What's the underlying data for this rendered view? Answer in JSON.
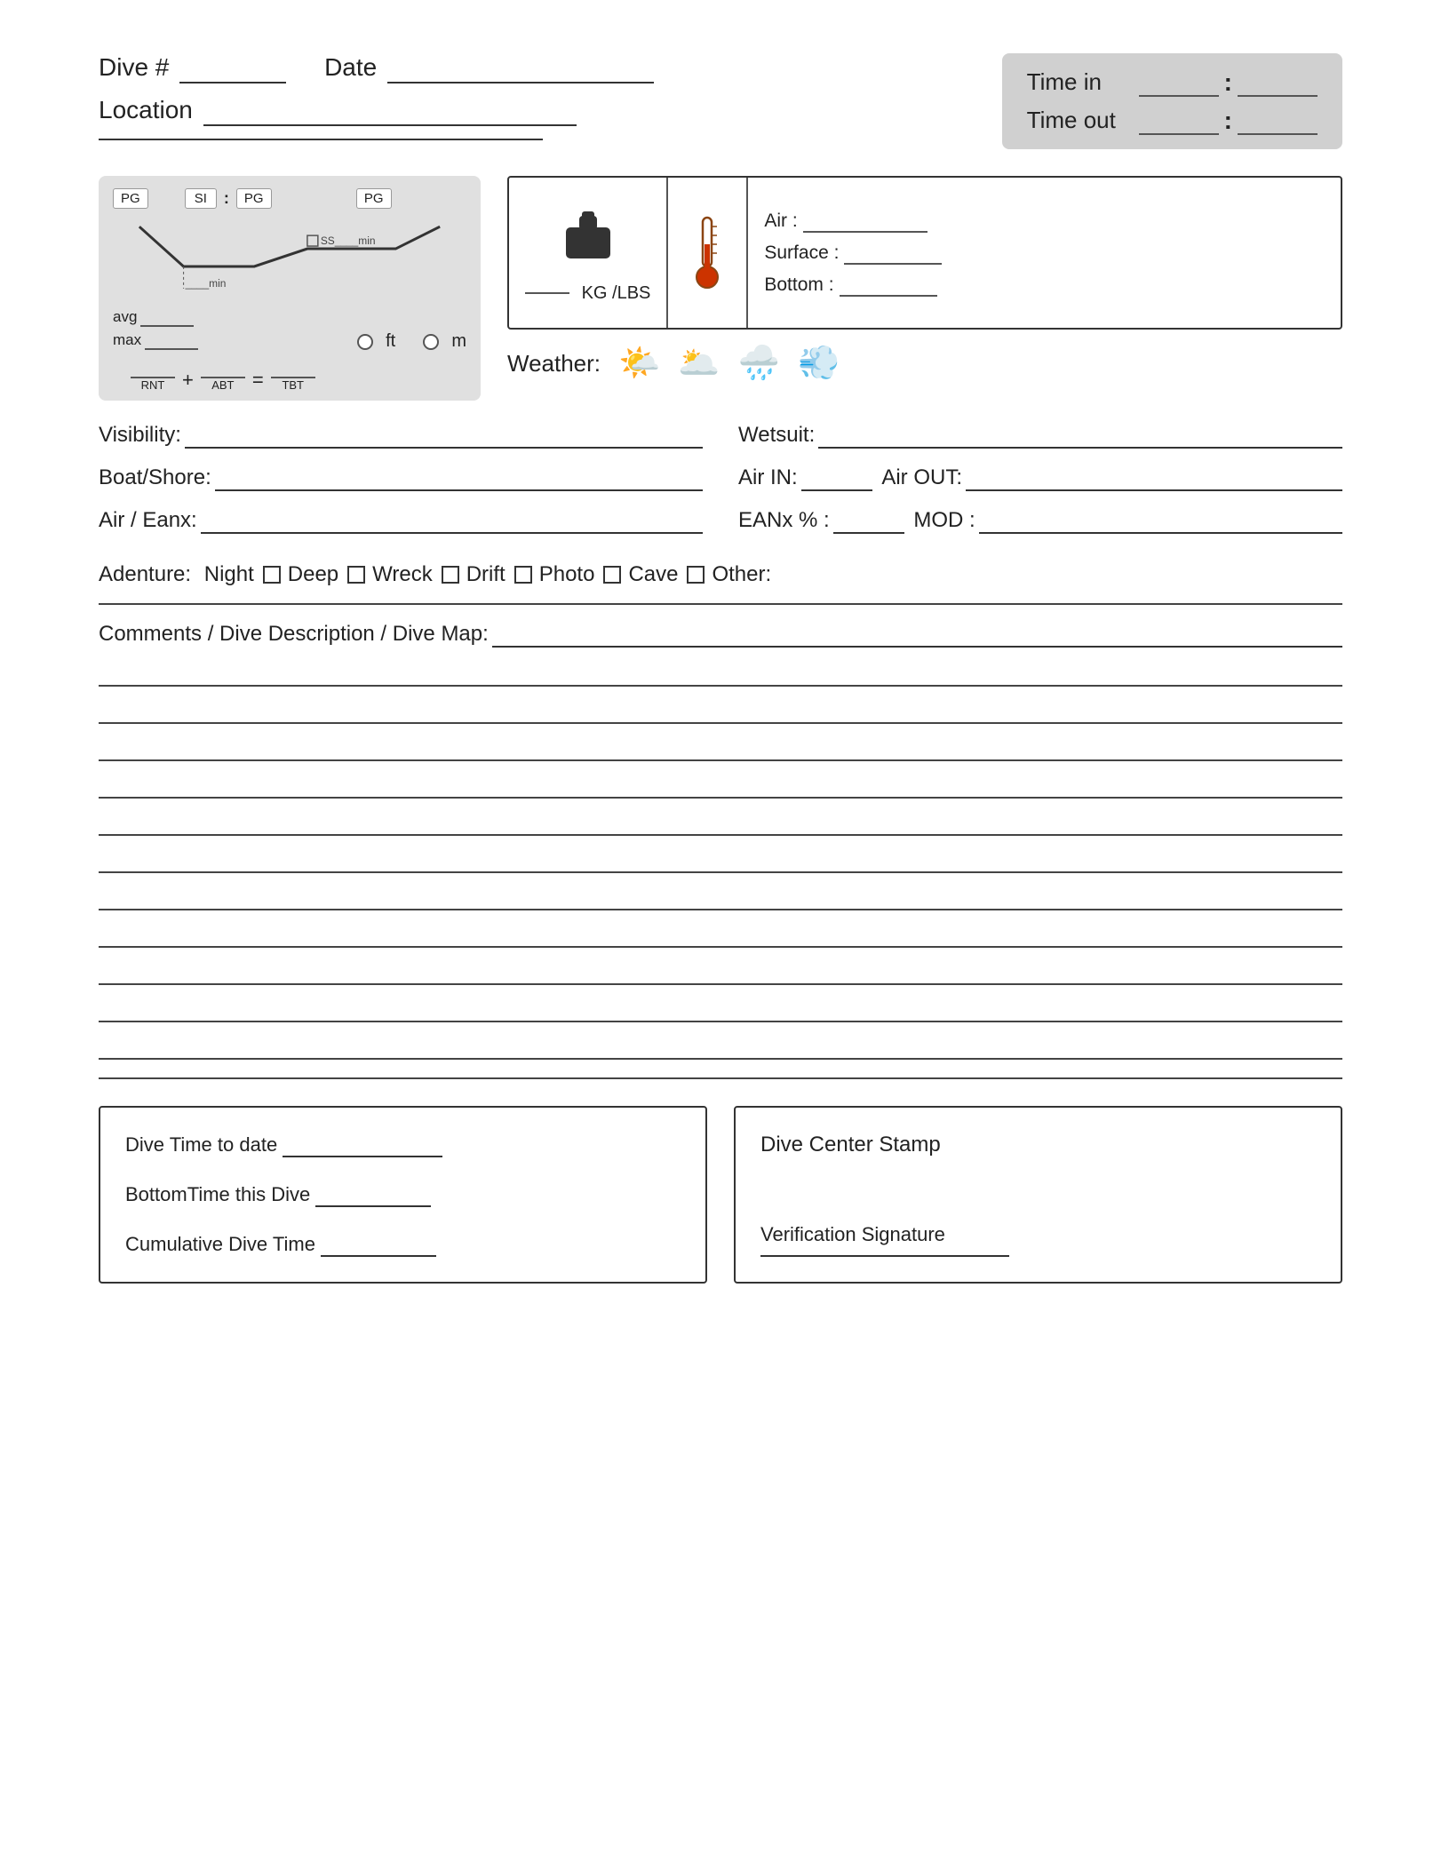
{
  "header": {
    "dive_label": "Dive #",
    "dive_field": "",
    "date_label": "Date",
    "date_field": "",
    "location_label": "Location",
    "location_field": ""
  },
  "time_box": {
    "time_in_label": "Time in",
    "time_out_label": "Time out"
  },
  "dive_profile": {
    "pg_label": "PG",
    "si_label": "SI",
    "avg_label": "avg",
    "max_label": "max",
    "min_label": "min",
    "ss_label": "SS",
    "min_suffix": "min",
    "ft_label": "ft",
    "m_label": "m",
    "rnt_label": "RNT",
    "abt_label": "ABT",
    "tbt_label": "TBT",
    "plus": "+",
    "equals": "="
  },
  "weight_temp": {
    "kg_lbs_label": "KG /LBS",
    "air_label": "Air :",
    "surface_label": "Surface :",
    "bottom_label": "Bottom :"
  },
  "weather": {
    "label": "Weather:"
  },
  "form": {
    "visibility_label": "Visibility:",
    "boat_shore_label": "Boat/Shore:",
    "air_eanx_label": "Air / Eanx:",
    "wetsuit_label": "Wetsuit:",
    "air_in_label": "Air IN:",
    "air_out_label": "Air OUT:",
    "eanx_pct_label": "EANx % :",
    "mod_label": "MOD :"
  },
  "adventure": {
    "label": "Adenture:",
    "items": [
      "Night",
      "Deep",
      "Wreck",
      "Drift",
      "Photo",
      "Cave",
      "Other:"
    ]
  },
  "comments": {
    "label": "Comments / Dive Description / Dive Map:"
  },
  "bottom_section": {
    "dive_time_to_date_label": "Dive Time to date",
    "bottom_time_label": "BottomTime this Dive",
    "cumulative_label": "Cumulative Dive Time",
    "dive_center_stamp_label": "Dive Center Stamp",
    "verification_label": "Verification Signature"
  }
}
